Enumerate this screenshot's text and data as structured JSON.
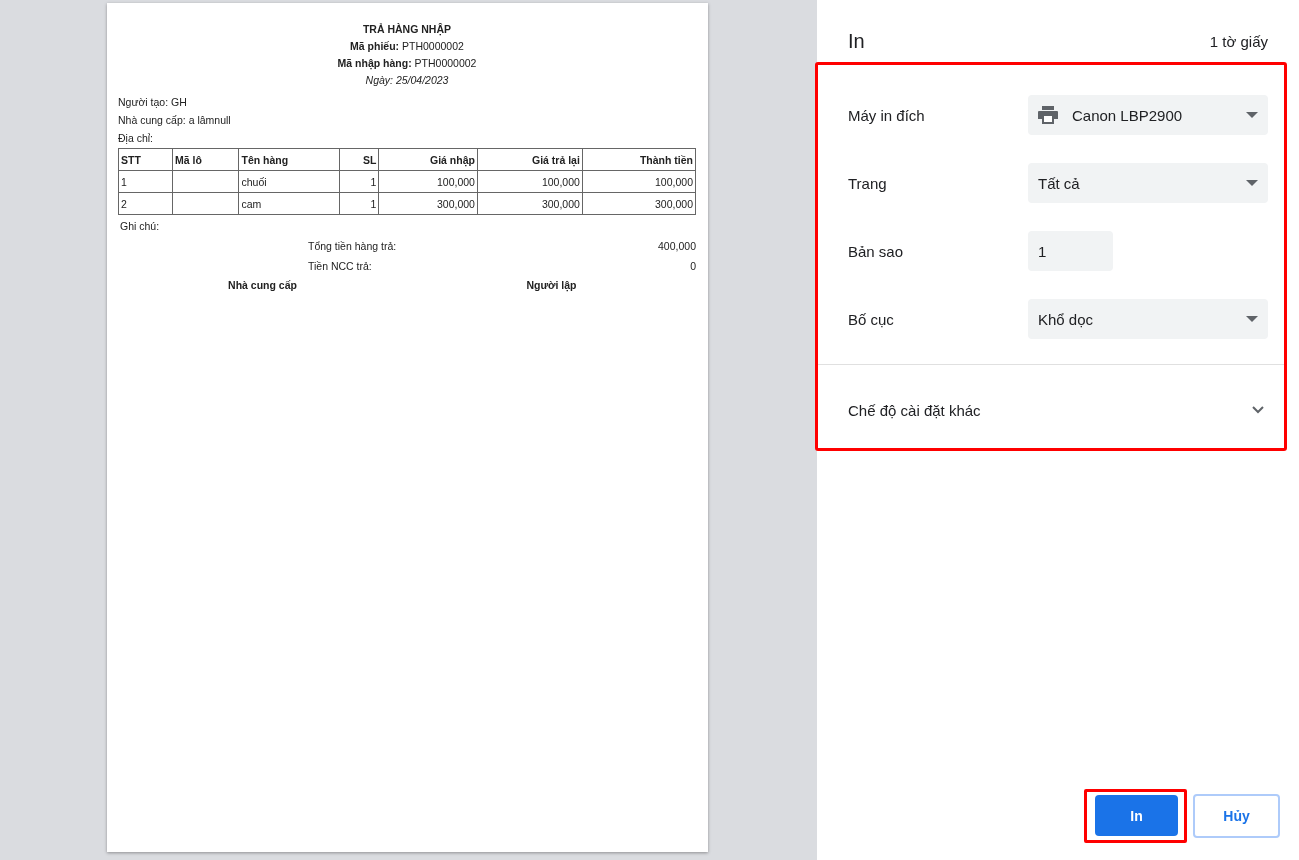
{
  "document": {
    "title": "TRẢ HÀNG NHẬP",
    "header_lines": [
      "**Mã phiếu:** PTH0000002",
      "**Mã nhập hàng:** PTH0000002"
    ],
    "date": "Ngày: 25/04/2023",
    "info_lines": [
      "Người tạo: GH",
      "Nhà cung cấp: a lâmnull",
      "Địa chỉ:"
    ],
    "table": {
      "columns": [
        "STT",
        "Mã lô",
        "Tên hàng",
        "SL",
        "Giá nhập",
        "Giá trả lại",
        "Thành tiền"
      ],
      "rows": [
        [
          "1",
          "",
          "chuối",
          "1",
          "100,000",
          "100,000",
          "100,000"
        ],
        [
          "2",
          "",
          "cam",
          "1",
          "300,000",
          "300,000",
          "300,000"
        ]
      ]
    },
    "note_label": "Ghi chú:",
    "totals": [
      {
        "label": "Tổng tiền hàng trả:",
        "value": "400,000"
      },
      {
        "label": "Tiền NCC trả:",
        "value": "0"
      }
    ],
    "signatures": [
      "Nhà cung cấp",
      "Người lập"
    ]
  },
  "print_panel": {
    "title": "In",
    "sheet_count": "1 tờ giấy",
    "settings": [
      {
        "label": "Máy in đích",
        "value": "Canon LBP2900",
        "kind": "printer"
      },
      {
        "label": "Trang",
        "value": "Tất cả",
        "kind": "select"
      },
      {
        "label": "Bản sao",
        "value": "1",
        "kind": "number"
      },
      {
        "label": "Bố cục",
        "value": "Khổ dọc",
        "kind": "select"
      }
    ],
    "more_settings": "Chế độ cài đặt khác",
    "buttons": [
      {
        "label": "In",
        "kind": "primary"
      },
      {
        "label": "Hủy",
        "kind": "secondary"
      }
    ]
  }
}
